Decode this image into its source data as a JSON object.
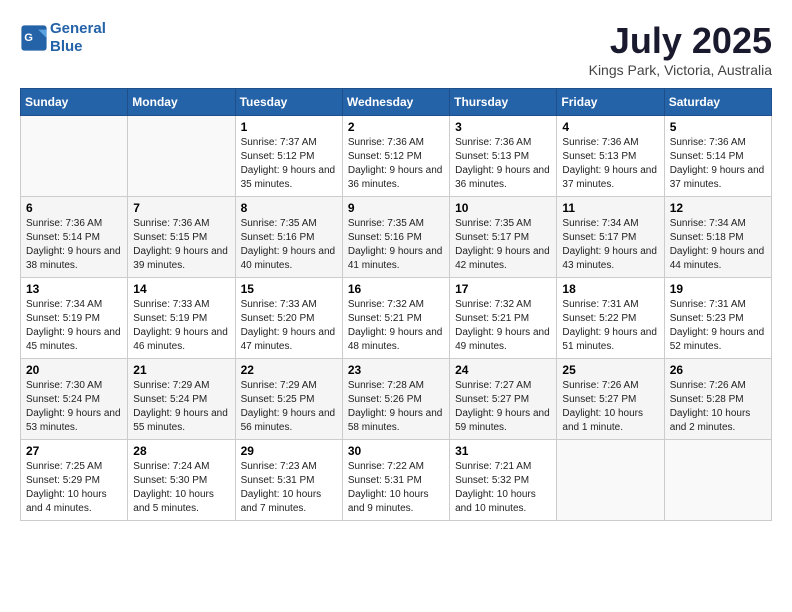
{
  "header": {
    "logo_line1": "General",
    "logo_line2": "Blue",
    "month": "July 2025",
    "location": "Kings Park, Victoria, Australia"
  },
  "weekdays": [
    "Sunday",
    "Monday",
    "Tuesday",
    "Wednesday",
    "Thursday",
    "Friday",
    "Saturday"
  ],
  "weeks": [
    [
      {
        "day": "",
        "sunrise": "",
        "sunset": "",
        "daylight": ""
      },
      {
        "day": "",
        "sunrise": "",
        "sunset": "",
        "daylight": ""
      },
      {
        "day": "1",
        "sunrise": "Sunrise: 7:37 AM",
        "sunset": "Sunset: 5:12 PM",
        "daylight": "Daylight: 9 hours and 35 minutes."
      },
      {
        "day": "2",
        "sunrise": "Sunrise: 7:36 AM",
        "sunset": "Sunset: 5:12 PM",
        "daylight": "Daylight: 9 hours and 36 minutes."
      },
      {
        "day": "3",
        "sunrise": "Sunrise: 7:36 AM",
        "sunset": "Sunset: 5:13 PM",
        "daylight": "Daylight: 9 hours and 36 minutes."
      },
      {
        "day": "4",
        "sunrise": "Sunrise: 7:36 AM",
        "sunset": "Sunset: 5:13 PM",
        "daylight": "Daylight: 9 hours and 37 minutes."
      },
      {
        "day": "5",
        "sunrise": "Sunrise: 7:36 AM",
        "sunset": "Sunset: 5:14 PM",
        "daylight": "Daylight: 9 hours and 37 minutes."
      }
    ],
    [
      {
        "day": "6",
        "sunrise": "Sunrise: 7:36 AM",
        "sunset": "Sunset: 5:14 PM",
        "daylight": "Daylight: 9 hours and 38 minutes."
      },
      {
        "day": "7",
        "sunrise": "Sunrise: 7:36 AM",
        "sunset": "Sunset: 5:15 PM",
        "daylight": "Daylight: 9 hours and 39 minutes."
      },
      {
        "day": "8",
        "sunrise": "Sunrise: 7:35 AM",
        "sunset": "Sunset: 5:16 PM",
        "daylight": "Daylight: 9 hours and 40 minutes."
      },
      {
        "day": "9",
        "sunrise": "Sunrise: 7:35 AM",
        "sunset": "Sunset: 5:16 PM",
        "daylight": "Daylight: 9 hours and 41 minutes."
      },
      {
        "day": "10",
        "sunrise": "Sunrise: 7:35 AM",
        "sunset": "Sunset: 5:17 PM",
        "daylight": "Daylight: 9 hours and 42 minutes."
      },
      {
        "day": "11",
        "sunrise": "Sunrise: 7:34 AM",
        "sunset": "Sunset: 5:17 PM",
        "daylight": "Daylight: 9 hours and 43 minutes."
      },
      {
        "day": "12",
        "sunrise": "Sunrise: 7:34 AM",
        "sunset": "Sunset: 5:18 PM",
        "daylight": "Daylight: 9 hours and 44 minutes."
      }
    ],
    [
      {
        "day": "13",
        "sunrise": "Sunrise: 7:34 AM",
        "sunset": "Sunset: 5:19 PM",
        "daylight": "Daylight: 9 hours and 45 minutes."
      },
      {
        "day": "14",
        "sunrise": "Sunrise: 7:33 AM",
        "sunset": "Sunset: 5:19 PM",
        "daylight": "Daylight: 9 hours and 46 minutes."
      },
      {
        "day": "15",
        "sunrise": "Sunrise: 7:33 AM",
        "sunset": "Sunset: 5:20 PM",
        "daylight": "Daylight: 9 hours and 47 minutes."
      },
      {
        "day": "16",
        "sunrise": "Sunrise: 7:32 AM",
        "sunset": "Sunset: 5:21 PM",
        "daylight": "Daylight: 9 hours and 48 minutes."
      },
      {
        "day": "17",
        "sunrise": "Sunrise: 7:32 AM",
        "sunset": "Sunset: 5:21 PM",
        "daylight": "Daylight: 9 hours and 49 minutes."
      },
      {
        "day": "18",
        "sunrise": "Sunrise: 7:31 AM",
        "sunset": "Sunset: 5:22 PM",
        "daylight": "Daylight: 9 hours and 51 minutes."
      },
      {
        "day": "19",
        "sunrise": "Sunrise: 7:31 AM",
        "sunset": "Sunset: 5:23 PM",
        "daylight": "Daylight: 9 hours and 52 minutes."
      }
    ],
    [
      {
        "day": "20",
        "sunrise": "Sunrise: 7:30 AM",
        "sunset": "Sunset: 5:24 PM",
        "daylight": "Daylight: 9 hours and 53 minutes."
      },
      {
        "day": "21",
        "sunrise": "Sunrise: 7:29 AM",
        "sunset": "Sunset: 5:24 PM",
        "daylight": "Daylight: 9 hours and 55 minutes."
      },
      {
        "day": "22",
        "sunrise": "Sunrise: 7:29 AM",
        "sunset": "Sunset: 5:25 PM",
        "daylight": "Daylight: 9 hours and 56 minutes."
      },
      {
        "day": "23",
        "sunrise": "Sunrise: 7:28 AM",
        "sunset": "Sunset: 5:26 PM",
        "daylight": "Daylight: 9 hours and 58 minutes."
      },
      {
        "day": "24",
        "sunrise": "Sunrise: 7:27 AM",
        "sunset": "Sunset: 5:27 PM",
        "daylight": "Daylight: 9 hours and 59 minutes."
      },
      {
        "day": "25",
        "sunrise": "Sunrise: 7:26 AM",
        "sunset": "Sunset: 5:27 PM",
        "daylight": "Daylight: 10 hours and 1 minute."
      },
      {
        "day": "26",
        "sunrise": "Sunrise: 7:26 AM",
        "sunset": "Sunset: 5:28 PM",
        "daylight": "Daylight: 10 hours and 2 minutes."
      }
    ],
    [
      {
        "day": "27",
        "sunrise": "Sunrise: 7:25 AM",
        "sunset": "Sunset: 5:29 PM",
        "daylight": "Daylight: 10 hours and 4 minutes."
      },
      {
        "day": "28",
        "sunrise": "Sunrise: 7:24 AM",
        "sunset": "Sunset: 5:30 PM",
        "daylight": "Daylight: 10 hours and 5 minutes."
      },
      {
        "day": "29",
        "sunrise": "Sunrise: 7:23 AM",
        "sunset": "Sunset: 5:31 PM",
        "daylight": "Daylight: 10 hours and 7 minutes."
      },
      {
        "day": "30",
        "sunrise": "Sunrise: 7:22 AM",
        "sunset": "Sunset: 5:31 PM",
        "daylight": "Daylight: 10 hours and 9 minutes."
      },
      {
        "day": "31",
        "sunrise": "Sunrise: 7:21 AM",
        "sunset": "Sunset: 5:32 PM",
        "daylight": "Daylight: 10 hours and 10 minutes."
      },
      {
        "day": "",
        "sunrise": "",
        "sunset": "",
        "daylight": ""
      },
      {
        "day": "",
        "sunrise": "",
        "sunset": "",
        "daylight": ""
      }
    ]
  ]
}
